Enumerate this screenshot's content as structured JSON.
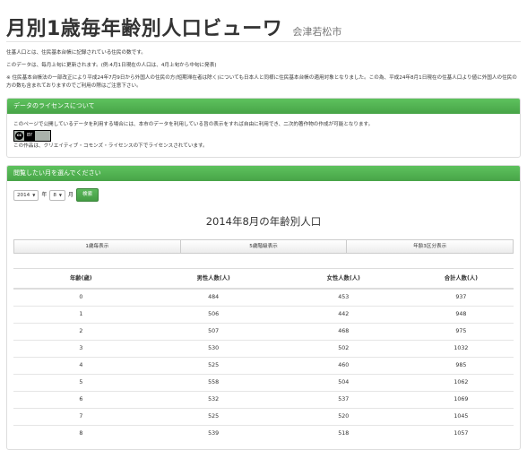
{
  "header": {
    "title": "月別1歳毎年齢別人口ビューワ",
    "subtitle": "会津若松市"
  },
  "intro": {
    "line1": "住基人口とは、住民基本台帳に記録されている住民の数です。",
    "line2": "このデータは、毎月上旬に更新されます。(例:4月1日現在の人口は、4月上旬から中旬に発表)",
    "note": "※ 住民基本台帳法の一部改正により平成24年7月9日から外国人の住民の方(短期滞在者は除く)についても日本人と同様に住民基本台帳の適用対象となりました。この為、平成24年8月1日現在の住基人口より値に外国人の住民の方の数も含まれておりますのでご利用の際はご注意下さい。"
  },
  "license_panel": {
    "heading": "データのライセンスについて",
    "text1": "このページで公開しているデータを利用する場合には、本市のデータを利用している旨の表示をすれば自由に利用でき、二次的著作物の作成が可能となります。",
    "badge_cc": "cc",
    "badge_by": "BY",
    "text2": "この作品は、クリエイティブ・コモンズ・ライセンスの下でライセンスされています。"
  },
  "month_panel": {
    "heading": "閲覧したい月を選んでください",
    "year_value": "2014",
    "year_suffix": "年",
    "month_value": "8",
    "month_suffix": "月",
    "search_label": "検索",
    "result_title": "2014年8月の年齢別人口",
    "tabs": [
      "1歳毎表示",
      "5歳階級表示",
      "年齢3区分表示"
    ]
  },
  "table": {
    "headers": [
      "年齢(歳)",
      "男性人数(人)",
      "女性人数(人)",
      "合計人数(人)"
    ],
    "rows": [
      [
        "0",
        "484",
        "453",
        "937"
      ],
      [
        "1",
        "506",
        "442",
        "948"
      ],
      [
        "2",
        "507",
        "468",
        "975"
      ],
      [
        "3",
        "530",
        "502",
        "1032"
      ],
      [
        "4",
        "525",
        "460",
        "985"
      ],
      [
        "5",
        "558",
        "504",
        "1062"
      ],
      [
        "6",
        "532",
        "537",
        "1069"
      ],
      [
        "7",
        "525",
        "520",
        "1045"
      ],
      [
        "8",
        "539",
        "518",
        "1057"
      ]
    ]
  },
  "colors": {
    "panel_header": "#5cb85c",
    "search_button": "#5cb85c"
  }
}
